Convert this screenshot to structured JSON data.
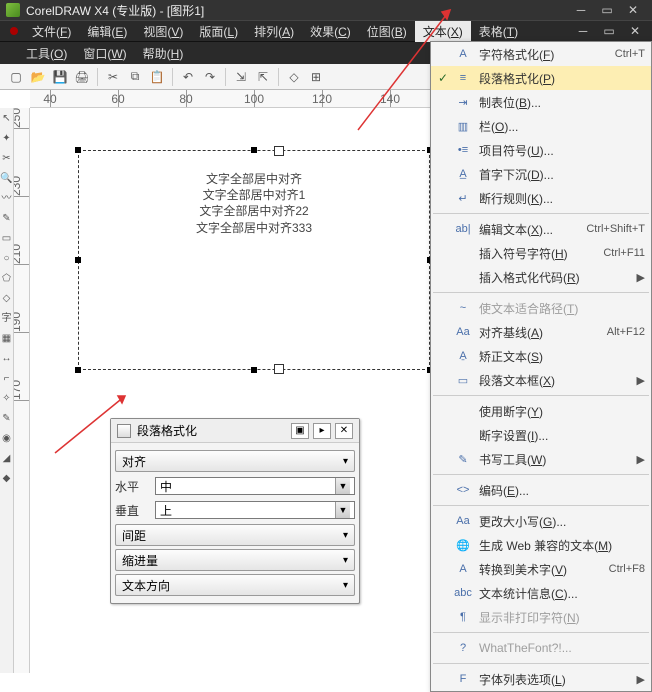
{
  "title": "CorelDRAW X4 (专业版) - [图形1]",
  "menubar1": [
    "文件(F)",
    "编辑(E)",
    "视图(V)",
    "版面(L)",
    "排列(A)",
    "效果(C)",
    "位图(B)",
    "文本(X)",
    "表格(T)"
  ],
  "menubar1_active_index": 7,
  "menubar2": [
    "工具(O)",
    "窗口(W)",
    "帮助(H)"
  ],
  "ruler_h": [
    "40",
    "60",
    "80",
    "100",
    "120",
    "140"
  ],
  "ruler_v": [
    "250",
    "230",
    "210",
    "190",
    "170"
  ],
  "text_lines": [
    "文字全部居中对齐",
    "文字全部居中对齐1",
    "文字全部居中对齐22",
    "文字全部居中对齐333"
  ],
  "docker": {
    "title": "段落格式化",
    "section1": "对齐",
    "horiz_label": "水平",
    "horiz_value": "中",
    "vert_label": "垂直",
    "vert_value": "上",
    "section2": "间距",
    "section3": "缩进量",
    "section4": "文本方向"
  },
  "dropdown": {
    "groups": [
      [
        {
          "icon": "char",
          "label": "字符格式化(F)",
          "shortcut": "Ctrl+T"
        },
        {
          "icon": "para",
          "label": "段落格式化(P)",
          "shortcut": "",
          "hl": true,
          "checked": true
        },
        {
          "icon": "tab",
          "label": "制表位(B)...",
          "shortcut": ""
        },
        {
          "icon": "cols",
          "label": "栏(O)...",
          "shortcut": ""
        },
        {
          "icon": "bull",
          "label": "项目符号(U)...",
          "shortcut": ""
        },
        {
          "icon": "drop",
          "label": "首字下沉(D)...",
          "shortcut": ""
        },
        {
          "icon": "break",
          "label": "断行规则(K)...",
          "shortcut": ""
        }
      ],
      [
        {
          "icon": "edit",
          "label": "编辑文本(X)...",
          "shortcut": "Ctrl+Shift+T"
        },
        {
          "icon": "",
          "label": "插入符号字符(H)",
          "shortcut": "Ctrl+F11"
        },
        {
          "icon": "",
          "label": "插入格式化代码(R)",
          "shortcut": "",
          "submenu": true
        }
      ],
      [
        {
          "icon": "path",
          "label": "使文本适合路径(T)",
          "shortcut": "",
          "disabled": true
        },
        {
          "icon": "base",
          "label": "对齐基线(A)",
          "shortcut": "Alt+F12"
        },
        {
          "icon": "fix",
          "label": "矫正文本(S)",
          "shortcut": ""
        },
        {
          "icon": "frame",
          "label": "段落文本框(X)",
          "shortcut": "",
          "submenu": true
        }
      ],
      [
        {
          "icon": "",
          "label": "使用断字(Y)",
          "shortcut": ""
        },
        {
          "icon": "",
          "label": "断字设置(I)...",
          "shortcut": ""
        },
        {
          "icon": "tools",
          "label": "书写工具(W)",
          "shortcut": "",
          "submenu": true
        }
      ],
      [
        {
          "icon": "enc",
          "label": "编码(E)...",
          "shortcut": ""
        }
      ],
      [
        {
          "icon": "case",
          "label": "更改大小写(G)...",
          "shortcut": ""
        },
        {
          "icon": "web",
          "label": "生成 Web 兼容的文本(M)",
          "shortcut": ""
        },
        {
          "icon": "art",
          "label": "转换到美术字(V)",
          "shortcut": "Ctrl+F8"
        },
        {
          "icon": "stat",
          "label": "文本统计信息(C)...",
          "shortcut": ""
        },
        {
          "icon": "np",
          "label": "显示非打印字符(N)",
          "shortcut": "",
          "disabled": true
        }
      ],
      [
        {
          "icon": "wtf",
          "label": "WhatTheFont?!...",
          "shortcut": "",
          "disabled": true
        }
      ],
      [
        {
          "icon": "font",
          "label": "字体列表选项(L)",
          "shortcut": "",
          "submenu": true
        }
      ]
    ]
  }
}
